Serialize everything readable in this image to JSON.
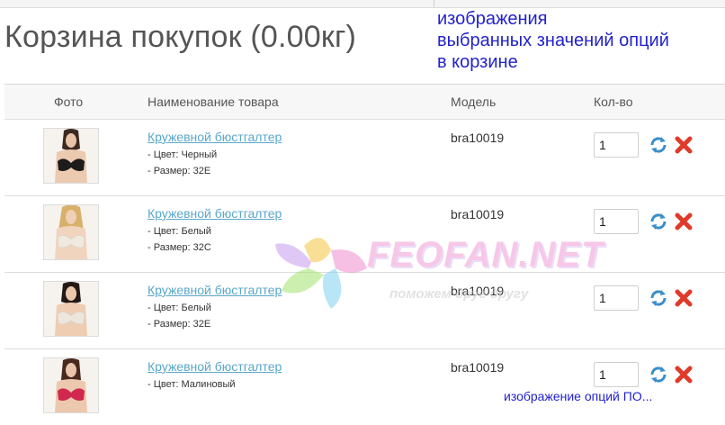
{
  "page": {
    "title": "Корзина покупок  (0.00кг)"
  },
  "annotation": {
    "lines": [
      "изображения",
      "выбранных значений опций",
      "в корзине"
    ]
  },
  "table": {
    "headers": {
      "photo": "Фото",
      "name": "Наименование товара",
      "model": "Модель",
      "quantity": "Кол-во"
    },
    "rows": [
      {
        "name": "Кружевной бюстгалтер",
        "options": [
          "- Цвет: Черный",
          "- Размер: 32E"
        ],
        "model": "bra10019",
        "quantity": "1",
        "bra_color": "#1c1c1c"
      },
      {
        "name": "Кружевной бюстгалтер",
        "options": [
          "- Цвет: Белый",
          "- Размер: 32C"
        ],
        "model": "bra10019",
        "quantity": "1",
        "bra_color": "#efe9df"
      },
      {
        "name": "Кружевной бюстгалтер",
        "options": [
          "- Цвет: Белый",
          "- Размер: 32E"
        ],
        "model": "bra10019",
        "quantity": "1",
        "bra_color": "#ece6dc"
      },
      {
        "name": "Кружевной бюстгалтер",
        "options": [
          "- Цвет: Малиновый"
        ],
        "model": "bra10019",
        "quantity": "1",
        "bra_color": "#d0284e"
      }
    ]
  },
  "icons": {
    "update": "refresh-icon",
    "remove": "remove-x-icon"
  },
  "colors": {
    "link": "#5aa7c9",
    "annotation": "#2222cc",
    "remove": "#e03a2a",
    "update": "#3a8fc9"
  },
  "watermark": {
    "text": "FEOFAN.NET",
    "subtitle": "поможем друг другу"
  },
  "footer_annotation": "изображение опций ПО..."
}
